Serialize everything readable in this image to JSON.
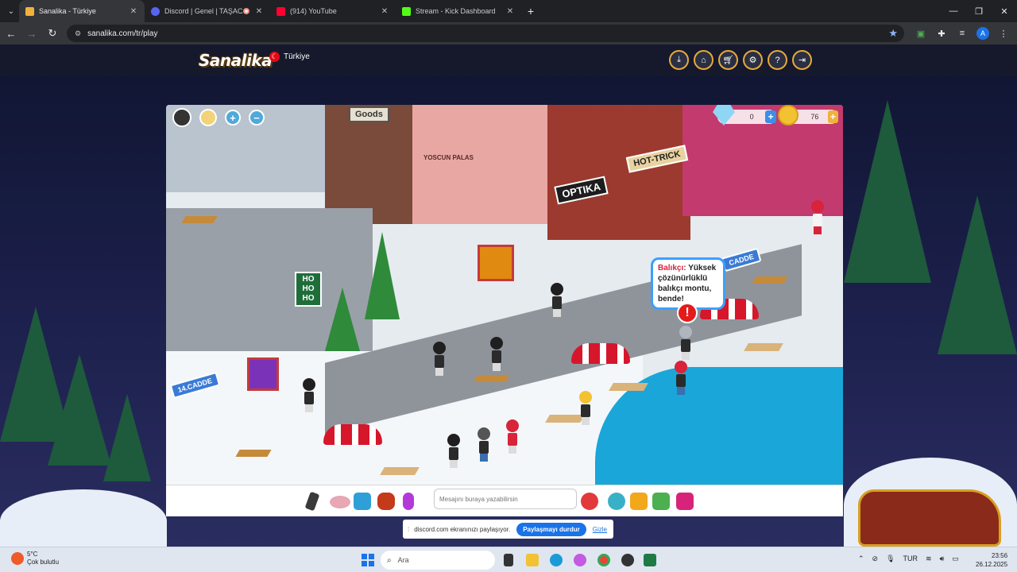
{
  "browser": {
    "tabs": [
      {
        "title": "Sanalika - Türkiye",
        "active": true
      },
      {
        "title": "Discord | Genel | TAŞACAK",
        "active": false
      },
      {
        "title": "(914) YouTube",
        "active": false
      },
      {
        "title": "Stream - Kick Dashboard",
        "active": false
      }
    ],
    "new_tab": "+",
    "url": "sanalika.com/tr/play",
    "window_controls": {
      "minimize": "—",
      "maximize": "❐",
      "close": "✕"
    }
  },
  "site": {
    "logo": "Sanalika",
    "country": "Türkiye",
    "header_icons": [
      "download-icon",
      "home-icon",
      "cart-icon",
      "settings-icon",
      "help-icon",
      "logout-icon"
    ]
  },
  "game": {
    "diamonds": "0",
    "coins": "76",
    "store_sign_optika": "OPTIKA",
    "store_sign_hottrick": "HOT-TRICK",
    "store_sign_goods": "Goods",
    "store_sign_yoscun": "YOSCUN PALAS",
    "street_sign_1": "14.CADDE",
    "street_sign_2": "CADDE",
    "hohoho": "HO HO HO",
    "speech": {
      "speaker": "Balıkçı:",
      "text": "Yüksek çözünürlüklü balıkçı montu, bende!"
    },
    "alert_mark": "!"
  },
  "chatbar": {
    "placeholder": "Mesajını buraya yazabilirsin"
  },
  "screen_share": {
    "message": "discord.com ekranınızı paylaşıyor.",
    "stop_label": "Paylaşmayı durdur",
    "hide_label": "Gizle"
  },
  "taskbar": {
    "weather_temp": "5°C",
    "weather_desc": "Çok bulutlu",
    "search_placeholder": "Ara",
    "language": "TUR",
    "time": "23:56",
    "date": "26.12.2025"
  },
  "colors": {
    "accent_blue": "#1a73e8",
    "header_ring": "#e8a93b",
    "water": "#1aa6d8",
    "speaker_red": "#d8233a"
  }
}
